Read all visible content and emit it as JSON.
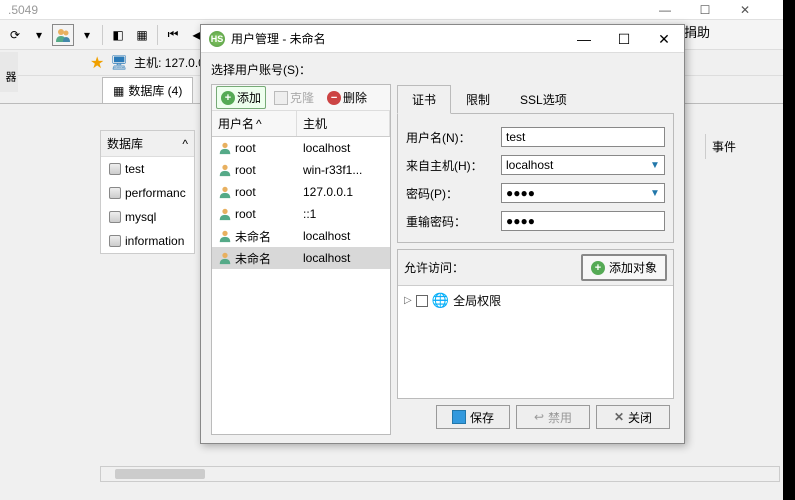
{
  "main": {
    "version": ".5049",
    "help_link": "目进行捐助",
    "host_label": "主机: 127.0.0.",
    "db_tab": "数据库 (4)"
  },
  "sidebar": {
    "header": "数据库",
    "filter": "",
    "items": [
      {
        "name": "test"
      },
      {
        "name": "performanc"
      },
      {
        "name": "mysql"
      },
      {
        "name": "information"
      }
    ]
  },
  "left_edge": "器",
  "events_header": "事件",
  "dialog": {
    "title": "用户管理 - 未命名",
    "select_label": "选择用户账号(S)：",
    "toolbar": {
      "add": "添加",
      "clone": "克隆",
      "delete": "删除"
    },
    "list_header": {
      "user": "用户名",
      "host": "主机"
    },
    "users": [
      {
        "name": "root",
        "host": "localhost"
      },
      {
        "name": "root",
        "host": "win-r33f1..."
      },
      {
        "name": "root",
        "host": "127.0.0.1"
      },
      {
        "name": "root",
        "host": "::1"
      },
      {
        "name": "未命名",
        "host": "localhost"
      },
      {
        "name": "未命名",
        "host": "localhost"
      }
    ],
    "tabs": {
      "cert": "证书",
      "limit": "限制",
      "ssl": "SSL选项"
    },
    "form": {
      "username_label": "用户名(N)：",
      "username_value": "test",
      "fromhost_label": "来自主机(H)：",
      "fromhost_value": "localhost",
      "password_label": "密码(P)：",
      "password_value": "●●●●",
      "repassword_label": "重输密码：",
      "repassword_value": "●●●●"
    },
    "access": {
      "label": "允许访问：",
      "add_object": "添加对象",
      "global": "全局权限"
    },
    "footer": {
      "save": "保存",
      "disable": "禁用",
      "close": "关闭"
    }
  }
}
